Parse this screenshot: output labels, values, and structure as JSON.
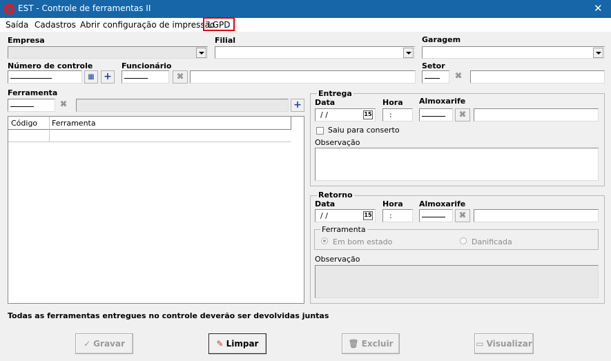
{
  "window": {
    "title": "EST - Controle de ferramentas II",
    "close": "✕"
  },
  "menu": {
    "items": [
      "Saída",
      "Cadastros",
      "Abrir configuração de impressão",
      "LGPD"
    ]
  },
  "header": {
    "empresa_label": "Empresa",
    "filial_label": "Filial",
    "garagem_label": "Garagem",
    "numero_controle_label": "Número de controle",
    "funcionario_label": "Funcionário",
    "setor_label": "Setor",
    "ferramenta_label": "Ferramenta"
  },
  "grid": {
    "columns": [
      "Código",
      "Ferramenta"
    ]
  },
  "entrega": {
    "title": "Entrega",
    "data_label": "Data",
    "data_value": "/ /",
    "calendar_day": "15",
    "hora_label": "Hora",
    "hora_value": ":",
    "almoxarife_label": "Almoxarife",
    "saiu_conserto_label": "Saiu para conserto",
    "observacao_label": "Observação"
  },
  "retorno": {
    "title": "Retorno",
    "data_label": "Data",
    "data_value": "/ /",
    "calendar_day": "15",
    "hora_label": "Hora",
    "hora_value": ":",
    "almoxarife_label": "Almoxarife",
    "ferramenta_group_label": "Ferramenta",
    "em_bom_estado_label": "Em bom estado",
    "danificada_label": "Danificada",
    "observacao_label": "Observação"
  },
  "footer_note": "Todas as ferramentas entregues  no controle deverão ser devolvidas juntas",
  "buttons": {
    "gravar": "Gravar",
    "limpar": "Limpar",
    "excluir": "Excluir",
    "visualizar": "Visualizar"
  },
  "colors": {
    "titlebar": "#1666a8",
    "highlight": "#e00000",
    "plus": "#1a47a0"
  }
}
